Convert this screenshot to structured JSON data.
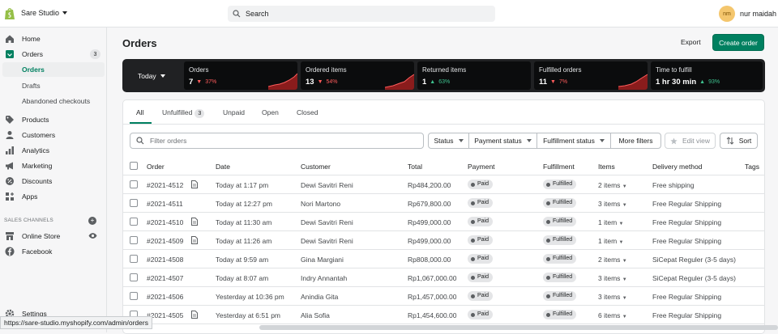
{
  "topbar": {
    "store_name": "Sare Studio",
    "search_placeholder": "Search",
    "user_initials": "nm",
    "user_name": "nur maidah"
  },
  "sidebar": {
    "items": [
      {
        "label": "Home",
        "icon": "home-icon"
      },
      {
        "label": "Orders",
        "icon": "orders-icon",
        "badge": "3"
      },
      {
        "label": "Orders",
        "sub": true,
        "active": true
      },
      {
        "label": "Drafts",
        "sub": true
      },
      {
        "label": "Abandoned checkouts",
        "sub": true
      },
      {
        "label": "Products",
        "icon": "tag-icon"
      },
      {
        "label": "Customers",
        "icon": "person-icon"
      },
      {
        "label": "Analytics",
        "icon": "bar-chart-icon"
      },
      {
        "label": "Marketing",
        "icon": "megaphone-icon"
      },
      {
        "label": "Discounts",
        "icon": "discount-icon"
      },
      {
        "label": "Apps",
        "icon": "apps-icon"
      }
    ],
    "sales_channels_label": "SALES CHANNELS",
    "channels": [
      {
        "label": "Online Store",
        "icon": "store-icon"
      },
      {
        "label": "Facebook",
        "icon": "facebook-icon"
      }
    ],
    "settings_label": "Settings"
  },
  "status_url": "https://sare-studio.myshopify.com/admin/orders",
  "page": {
    "title": "Orders",
    "export_label": "Export",
    "create_label": "Create order"
  },
  "metrics": {
    "period": "Today",
    "cells": [
      {
        "label": "Orders",
        "value": "7",
        "delta": "37%",
        "trend": "down"
      },
      {
        "label": "Ordered items",
        "value": "13",
        "delta": "54%",
        "trend": "down"
      },
      {
        "label": "Returned items",
        "value": "1",
        "delta": "63%",
        "trend": "up"
      },
      {
        "label": "Fulfilled orders",
        "value": "11",
        "delta": "7%",
        "trend": "down"
      },
      {
        "label": "Time to fulfill",
        "value": "1 hr 30 min",
        "delta": "93%",
        "trend": "up"
      }
    ]
  },
  "tabs": [
    {
      "label": "All"
    },
    {
      "label": "Unfulfilled",
      "badge": "3"
    },
    {
      "label": "Unpaid"
    },
    {
      "label": "Open"
    },
    {
      "label": "Closed"
    }
  ],
  "filters": {
    "placeholder": "Filter orders",
    "status": "Status",
    "payment_status": "Payment status",
    "fulfillment_status": "Fulfillment status",
    "more": "More filters",
    "edit_view": "Edit view",
    "sort": "Sort"
  },
  "table": {
    "headers": [
      "Order",
      "Date",
      "Customer",
      "Total",
      "Payment",
      "Fulfillment",
      "Items",
      "Delivery method",
      "Tags"
    ],
    "rows": [
      {
        "order": "#2021-4512",
        "note": true,
        "date": "Today at 1:17 pm",
        "customer": "Dewi Savitri Reni",
        "total": "Rp484,200.00",
        "payment": "Paid",
        "fulfillment": "Fulfilled",
        "items": "2 items",
        "delivery": "Free shipping"
      },
      {
        "order": "#2021-4511",
        "note": false,
        "date": "Today at 12:27 pm",
        "customer": "Nori Martono",
        "total": "Rp679,800.00",
        "payment": "Paid",
        "fulfillment": "Fulfilled",
        "items": "3 items",
        "delivery": "Free Regular Shipping"
      },
      {
        "order": "#2021-4510",
        "note": true,
        "date": "Today at 11:30 am",
        "customer": "Dewi Savitri Reni",
        "total": "Rp499,000.00",
        "payment": "Paid",
        "fulfillment": "Fulfilled",
        "items": "1 item",
        "delivery": "Free Regular Shipping"
      },
      {
        "order": "#2021-4509",
        "note": true,
        "date": "Today at 11:26 am",
        "customer": "Dewi Savitri Reni",
        "total": "Rp499,000.00",
        "payment": "Paid",
        "fulfillment": "Fulfilled",
        "items": "1 item",
        "delivery": "Free Regular Shipping"
      },
      {
        "order": "#2021-4508",
        "note": false,
        "date": "Today at 9:59 am",
        "customer": "Gina Margiani",
        "total": "Rp808,000.00",
        "payment": "Paid",
        "fulfillment": "Fulfilled",
        "items": "2 items",
        "delivery": "SiCepat Reguler (3-5 days)"
      },
      {
        "order": "#2021-4507",
        "note": false,
        "date": "Today at 8:07 am",
        "customer": "Indry Annantah",
        "total": "Rp1,067,000.00",
        "payment": "Paid",
        "fulfillment": "Fulfilled",
        "items": "3 items",
        "delivery": "SiCepat Reguler (3-5 days)"
      },
      {
        "order": "#2021-4506",
        "note": false,
        "date": "Yesterday at 10:36 pm",
        "customer": "Anindia Gita",
        "total": "Rp1,457,000.00",
        "payment": "Paid",
        "fulfillment": "Fulfilled",
        "items": "3 items",
        "delivery": "Free Regular Shipping"
      },
      {
        "order": "#2021-4505",
        "note": true,
        "date": "Yesterday at 6:51 pm",
        "customer": "Alia Sofia",
        "total": "Rp1,454,600.00",
        "payment": "Paid",
        "fulfillment": "Fulfilled",
        "items": "6 items",
        "delivery": "Free Regular Shipping"
      }
    ]
  },
  "colors": {
    "accent": "#008060",
    "metrics_bg": "#202123",
    "down": "#ff5c5c",
    "up": "#3ec28f"
  }
}
